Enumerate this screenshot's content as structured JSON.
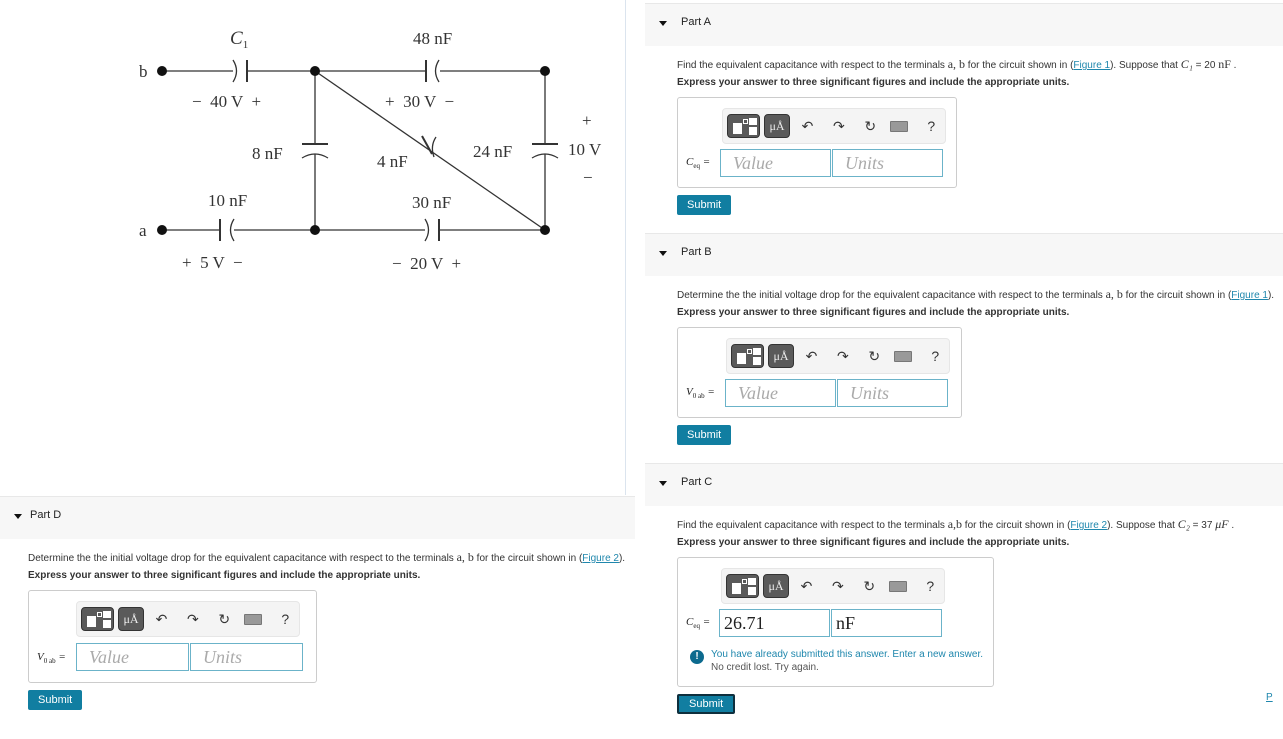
{
  "figure": {
    "terminals": {
      "a": "a",
      "b": "b"
    },
    "components": {
      "c1": {
        "label": "C",
        "sub": "1",
        "voltage": "−  40 V  +"
      },
      "c48": {
        "label": "48 nF",
        "voltage": "+  30 V  −"
      },
      "c8": {
        "label": "8 nF"
      },
      "c4": {
        "label": "4 nF"
      },
      "c24": {
        "label": "24 nF",
        "voltage": "10 V",
        "plus": "+",
        "minus": "−"
      },
      "c10": {
        "label": "10 nF",
        "voltage": "+  5 V  −"
      },
      "c30": {
        "label": "30 nF",
        "voltage": "−  20 V  +"
      }
    }
  },
  "toolbar": {
    "mu_label": "μÅ",
    "undo": "↶",
    "redo": "↷",
    "reset": "↻",
    "help": "?"
  },
  "parts": {
    "A": {
      "title": "Part A",
      "q_pre": "Find the equivalent capacitance with respect to the terminals ",
      "q_terms": "a, b",
      "q_mid": " for the circuit shown in (",
      "figure_link": "Figure 1",
      "q_post": "). Suppose that ",
      "q_var": "C₁",
      "q_eq": " = 20 ",
      "q_unit": "nF",
      "q_end": " .",
      "instruction": "Express your answer to three significant figures and include the appropriate units.",
      "field_label": "C",
      "field_sub": "eq",
      "value_placeholder": "Value",
      "units_placeholder": "Units",
      "submit": "Submit"
    },
    "B": {
      "title": "Part B",
      "q_pre": "Determine the the initial voltage drop for the equivalent capacitance with respect to the terminals ",
      "q_terms": "a, b",
      "q_mid": " for the circuit shown in (",
      "figure_link": "Figure 1",
      "q_end": ").",
      "instruction": "Express your answer to three significant figures and include the appropriate units.",
      "field_label": "V",
      "field_sub": "0 ab",
      "value_placeholder": "Value",
      "units_placeholder": "Units",
      "submit": "Submit"
    },
    "C": {
      "title": "Part C",
      "q_pre": "Find the equivalent capacitance with respect to the terminals ",
      "q_terms": "a,b",
      "q_mid": " for the circuit shown in (",
      "figure_link": "Figure 2",
      "q_post": "). Suppose that ",
      "q_var": "C₂",
      "q_eq": " = 37 ",
      "q_unit": "μF",
      "q_end": " .",
      "instruction": "Express your answer to three significant figures and include the appropriate units.",
      "field_label": "C",
      "field_sub": "eq",
      "value": "26.71",
      "units": "nF",
      "feedback_main": "You have already submitted this answer. Enter a new answer.",
      "feedback_sub": "No credit lost. Try again.",
      "submit": "Submit"
    },
    "D": {
      "title": "Part D",
      "q_pre": "Determine the the initial voltage drop for the equivalent capacitance with respect to the terminals ",
      "q_terms": "a, b",
      "q_mid": " for the circuit shown in (",
      "figure_link": "Figure 2",
      "q_end": ").",
      "instruction": "Express your answer to three significant figures and include the appropriate units.",
      "field_label": "V",
      "field_sub": "0 ab",
      "value_placeholder": "Value",
      "units_placeholder": "Units",
      "submit": "Submit"
    }
  },
  "corner_link": "P"
}
